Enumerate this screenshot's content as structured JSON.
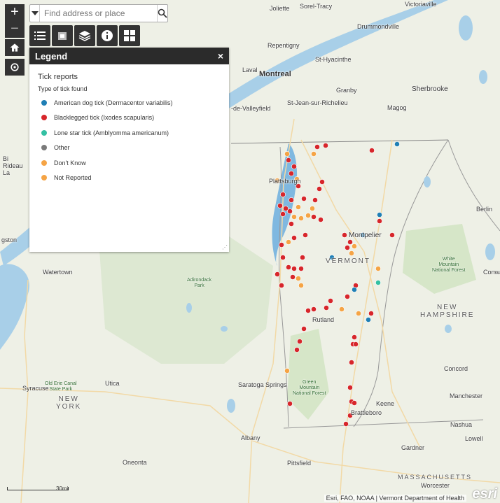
{
  "search": {
    "placeholder": "Find address or place"
  },
  "legend": {
    "title": "Legend",
    "close_label": "×",
    "layer_title": "Tick reports",
    "subtitle": "Type of tick found",
    "items": [
      {
        "label": "American dog tick (Dermacentor variabilis)",
        "color": "#1f7fb5"
      },
      {
        "label": "Blacklegged tick (Ixodes scapularis)",
        "color": "#d7262b"
      },
      {
        "label": "Lone star tick (Amblyomma americanum)",
        "color": "#33c0a3"
      },
      {
        "label": "Other",
        "color": "#7a7a7a"
      },
      {
        "label": "Don't Know",
        "color": "#f5a445"
      },
      {
        "label": "Not Reported",
        "color": "#f5a445"
      }
    ]
  },
  "places": {
    "joliette": "Joliette",
    "sorel": "Sorel-Tracy",
    "victoriaville": "Victoriaville",
    "drummondville": "Drummondville",
    "repentigny": "Repentigny",
    "st_hyacinthe": "St-Hyacinthe",
    "laval": "Laval",
    "montreal": "Montreal",
    "granby": "Granby",
    "sherbrooke": "Sherbrooke",
    "valleyfield": "-de-Valleyfield",
    "st_jean": "St-Jean-sur-Richelieu",
    "magog": "Magog",
    "plattsburgh": "Plattsburgh",
    "montpelier": "Montpelier",
    "vermont": "VERMONT",
    "berlin": "Berlin",
    "ogdensburg": "gston",
    "watertown": "Watertown",
    "adirondack": "Adirondack\nPark",
    "white_mountain": "White\nMountain\nNational Forest",
    "conway": "Conwa",
    "new_hampshire": "NEW\nHAMPSHIRE",
    "rutland": "Rutland",
    "concord": "Concord",
    "syracuse": "Syracuse",
    "erie_canal": "Old Erie Canal\nState Park",
    "utica": "Utica",
    "saratoga": "Saratoga Springs",
    "green_mountain": "Green\nMountain\nNational Forest",
    "new_york": "NEW\nYORK",
    "keene": "Keene",
    "manchester": "Manchester",
    "brattleboro": "Brattleboro",
    "nashua": "Nashua",
    "albany": "Albany",
    "lowell": "Lowell",
    "gardner": "Gardner",
    "oneonta": "Oneonta",
    "pittsfield": "Pittsfield",
    "massachusetts": "MASSACHUSETTS",
    "worcester": "Worcester",
    "bi_rideau": "Bi\nRideau\nLa"
  },
  "scale_label": "30mi",
  "attribution": "Esri, FAO, NOAA | Vermont Department of Health",
  "logo_text": "esri"
}
